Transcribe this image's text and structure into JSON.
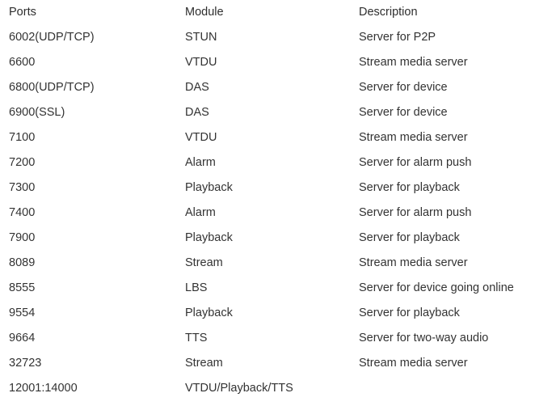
{
  "table": {
    "columns": [
      {
        "key": "ports",
        "label": "Ports"
      },
      {
        "key": "module",
        "label": "Module"
      },
      {
        "key": "description",
        "label": "Description"
      }
    ],
    "rows": [
      {
        "ports": "6002(UDP/TCP)",
        "module": "STUN",
        "description": "Server for P2P"
      },
      {
        "ports": "6600",
        "module": "VTDU",
        "description": "Stream media server"
      },
      {
        "ports": "6800(UDP/TCP)",
        "module": "DAS",
        "description": "Server for device"
      },
      {
        "ports": "6900(SSL)",
        "module": "DAS",
        "description": "Server for device"
      },
      {
        "ports": "7100",
        "module": "VTDU",
        "description": "Stream media server"
      },
      {
        "ports": "7200",
        "module": "Alarm",
        "description": "Server for alarm push"
      },
      {
        "ports": "7300",
        "module": "Playback",
        "description": "Server for playback"
      },
      {
        "ports": "7400",
        "module": "Alarm",
        "description": "Server for alarm push"
      },
      {
        "ports": "7900",
        "module": "Playback",
        "description": "Server for playback"
      },
      {
        "ports": "8089",
        "module": "Stream",
        "description": "Stream media server"
      },
      {
        "ports": "8555",
        "module": "LBS",
        "description": "Server for device going online"
      },
      {
        "ports": "9554",
        "module": "Playback",
        "description": "Server for playback"
      },
      {
        "ports": "9664",
        "module": "TTS",
        "description": "Server for two-way audio"
      },
      {
        "ports": "32723",
        "module": "Stream",
        "description": "Stream media server"
      },
      {
        "ports": "12001:14000",
        "module": "VTDU/Playback/TTS",
        "description": ""
      }
    ]
  },
  "colors": {
    "background": "#ffffff",
    "header_text": "#2e2e2e",
    "body_text": "#333333"
  }
}
